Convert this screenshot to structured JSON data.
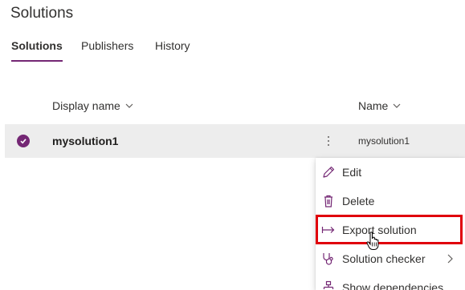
{
  "page": {
    "title": "Solutions"
  },
  "tabs": [
    {
      "label": "Solutions",
      "active": true
    },
    {
      "label": "Publishers",
      "active": false
    },
    {
      "label": "History",
      "active": false
    }
  ],
  "table": {
    "columns": [
      {
        "label": "Display name"
      },
      {
        "label": "Name"
      }
    ],
    "rows": [
      {
        "display_name": "mysolution1",
        "name": "mysolution1",
        "selected": true
      }
    ]
  },
  "context_menu": {
    "items": [
      {
        "label": "Edit",
        "icon": "pencil-icon"
      },
      {
        "label": "Delete",
        "icon": "trash-icon"
      },
      {
        "label": "Export solution",
        "icon": "export-arrow-icon",
        "highlighted": true
      },
      {
        "label": "Solution checker",
        "icon": "stethoscope-icon",
        "has_submenu": true
      },
      {
        "label": "Show dependencies",
        "icon": "dependency-tree-icon"
      }
    ]
  },
  "colors": {
    "accent": "#742774",
    "highlight_border": "#e0000b",
    "row_background": "#ededed"
  }
}
